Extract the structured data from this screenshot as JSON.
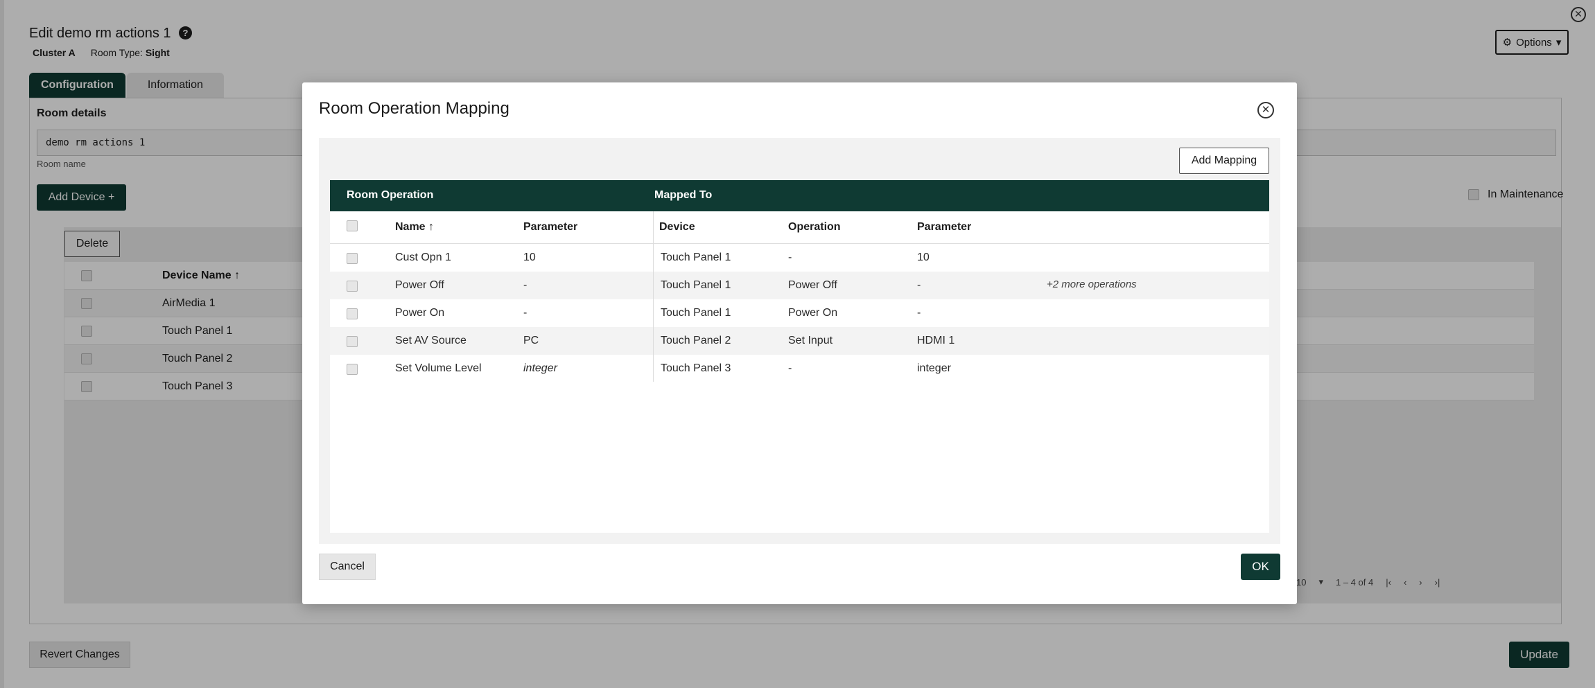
{
  "page": {
    "title": "Edit demo rm actions 1",
    "cluster": "Cluster A",
    "room_type_label": "Room Type:",
    "room_type_value": "Sight",
    "options_label": "Options",
    "tabs": [
      {
        "label": "Configuration",
        "active": true
      },
      {
        "label": "Information",
        "active": false
      }
    ],
    "room_details_label": "Room details",
    "room_name_value": "demo rm actions 1",
    "room_name_help": "Room name",
    "add_device_label": "Add Device +",
    "maintenance_label": "In Maintenance",
    "delete_label": "Delete",
    "device_table": {
      "header": "Device Name ↑",
      "rows": [
        "AirMedia 1",
        "Touch Panel 1",
        "Touch Panel 2",
        "Touch Panel 3"
      ]
    },
    "pager": {
      "page_size": "10",
      "range": "1 – 4 of 4"
    },
    "revert_label": "Revert Changes",
    "update_label": "Update"
  },
  "modal": {
    "title": "Room Operation Mapping",
    "add_mapping_label": "Add Mapping",
    "group_headers": {
      "room_operation": "Room Operation",
      "mapped_to": "Mapped To"
    },
    "columns": {
      "name": "Name ↑",
      "parameter": "Parameter",
      "device": "Device",
      "operation": "Operation",
      "mapped_parameter": "Parameter"
    },
    "rows": [
      {
        "name": "Cust Opn 1",
        "parameter": "10",
        "device": "Touch Panel 1",
        "operation": "-",
        "mapped_parameter": "10",
        "extra": ""
      },
      {
        "name": "Power Off",
        "parameter": "-",
        "device": "Touch Panel 1",
        "operation": "Power Off",
        "mapped_parameter": "-",
        "extra": "+2 more operations"
      },
      {
        "name": "Power On",
        "parameter": "-",
        "device": "Touch Panel 1",
        "operation": "Power On",
        "mapped_parameter": "-",
        "extra": ""
      },
      {
        "name": "Set AV Source",
        "parameter": "PC",
        "device": "Touch Panel 2",
        "operation": "Set Input",
        "mapped_parameter": "HDMI 1",
        "extra": ""
      },
      {
        "name": "Set Volume Level",
        "parameter": "integer",
        "device": "Touch Panel 3",
        "operation": "-",
        "mapped_parameter": "integer",
        "extra": ""
      }
    ],
    "cancel_label": "Cancel",
    "ok_label": "OK"
  },
  "colors": {
    "accent": "#0f3a33",
    "overlay": "rgba(0,0,0,0.32)"
  }
}
